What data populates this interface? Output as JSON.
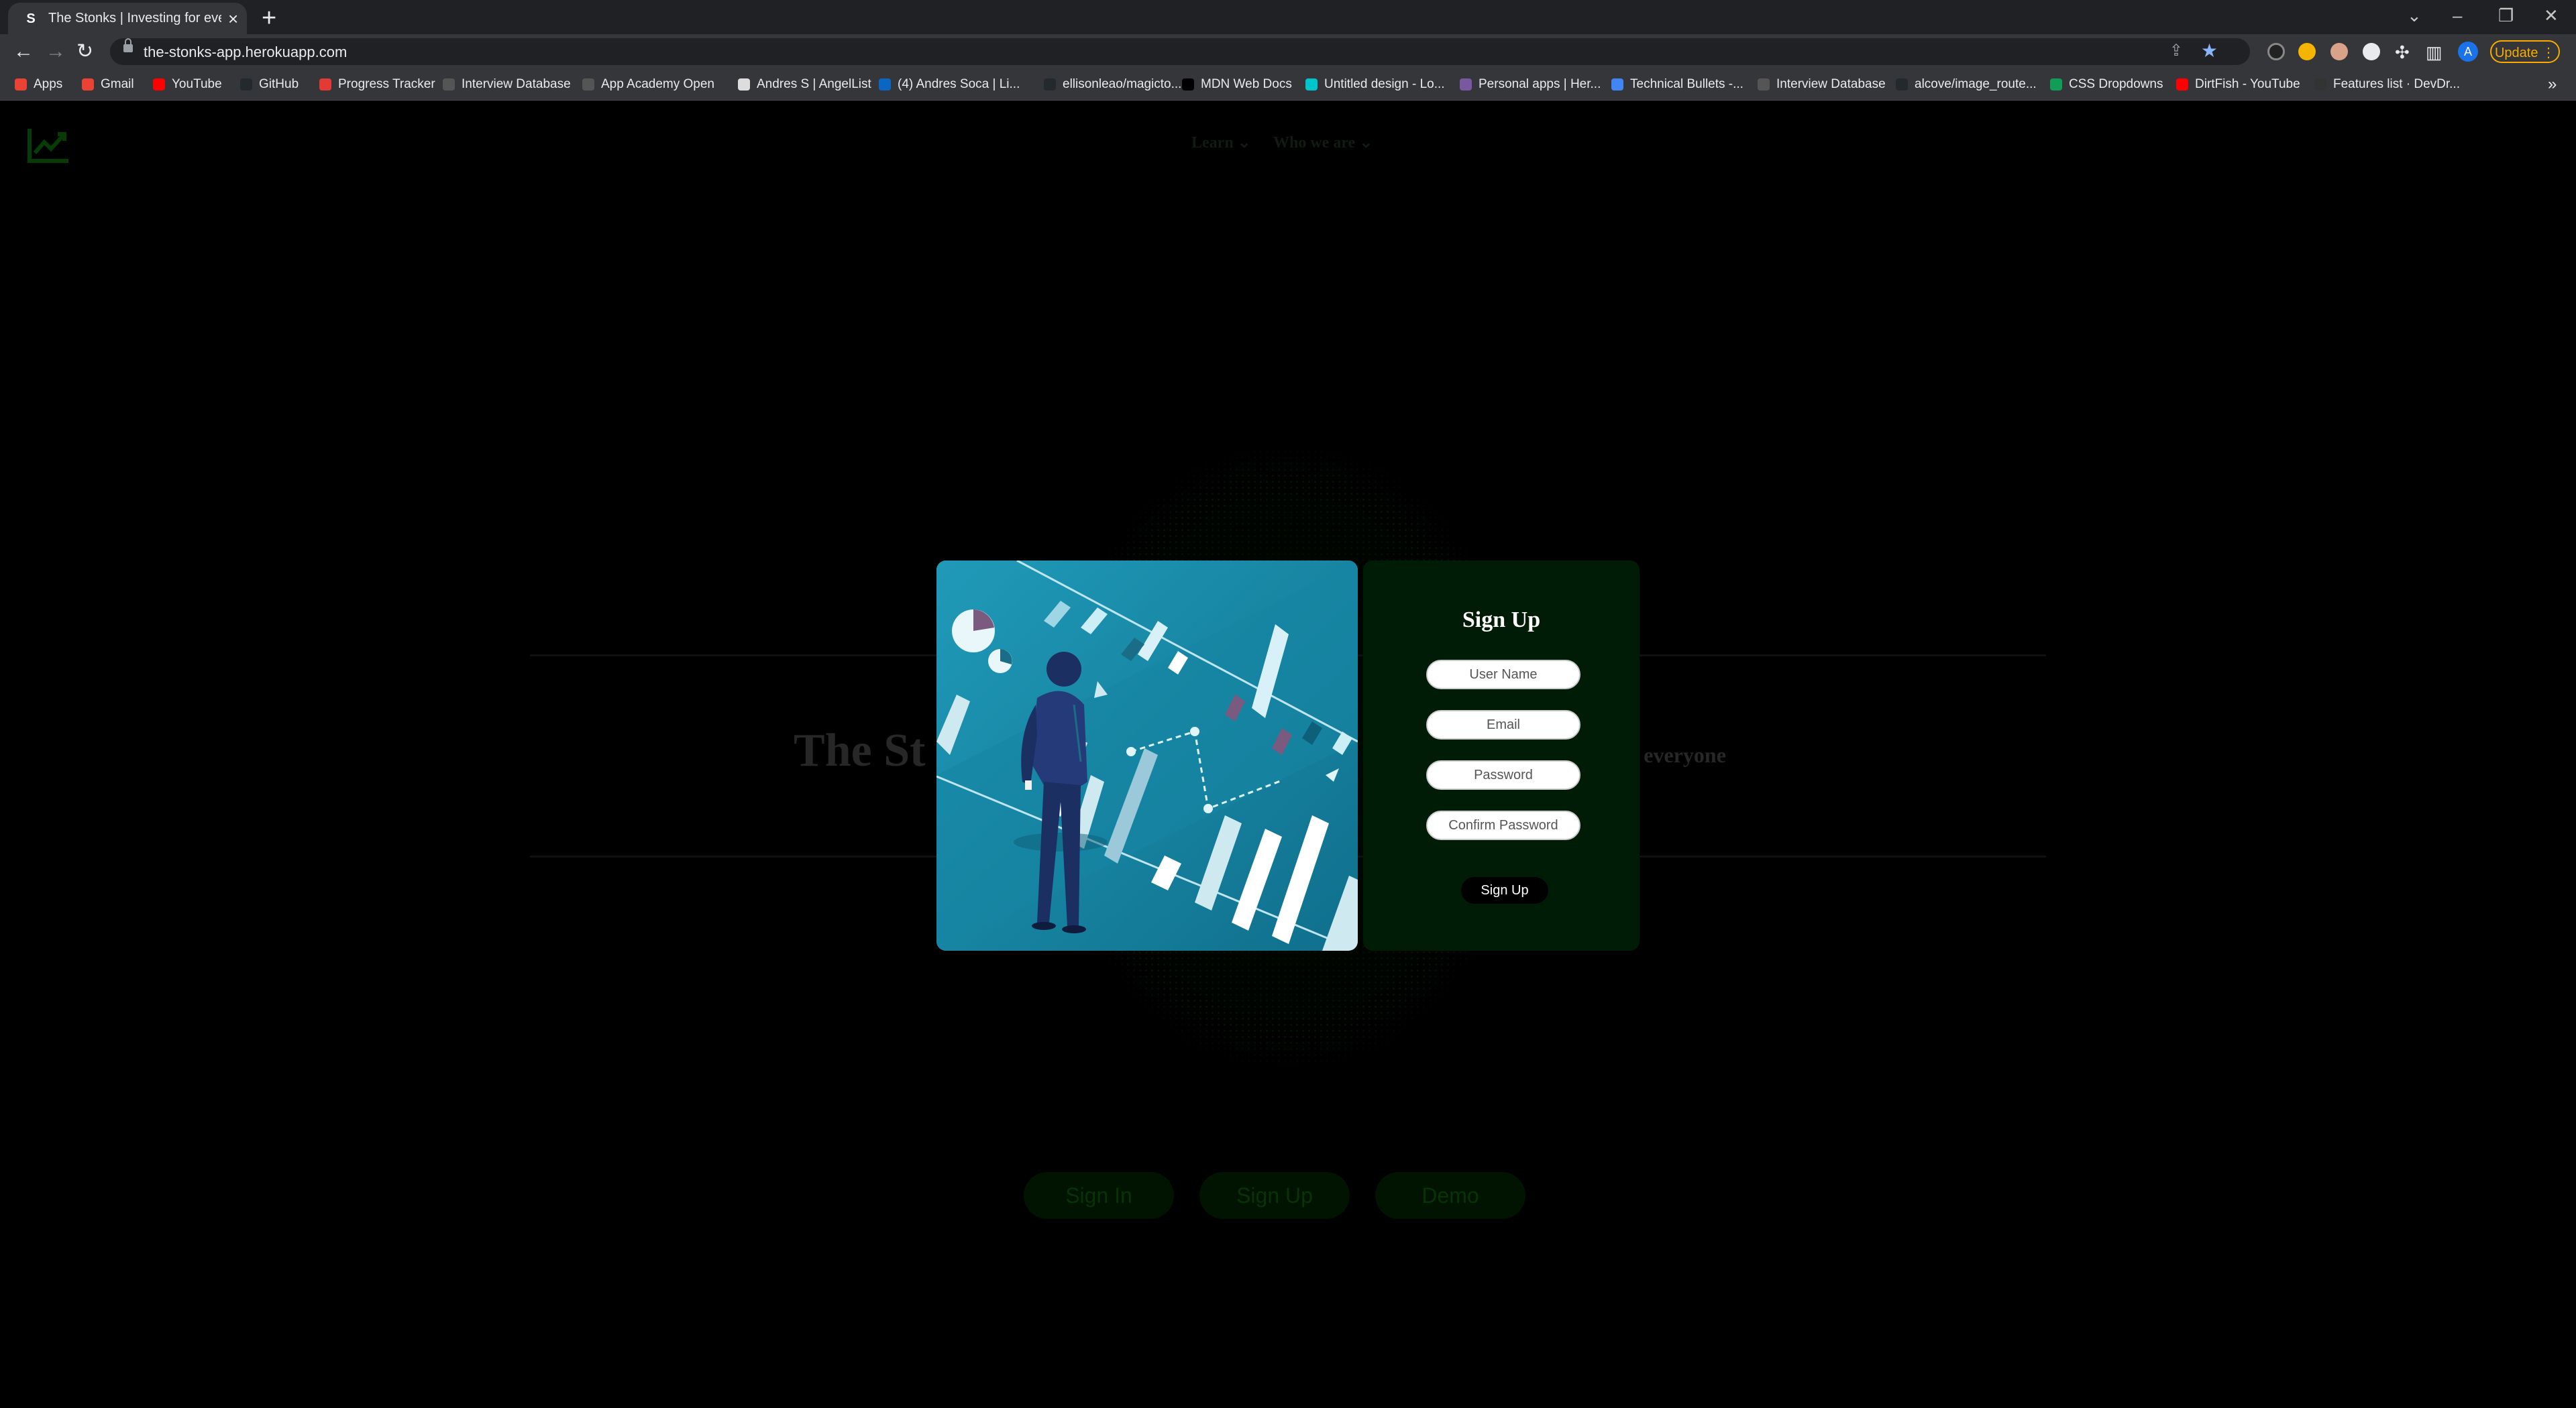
{
  "browser": {
    "tab_title": "The Stonks | Investing for everyo",
    "tab_favicon": "S",
    "new_tab": "+",
    "url": "the-stonks-app.herokuapp.com",
    "profile_initial": "A",
    "update_label": "Update",
    "bookmarks": [
      {
        "label": "Apps",
        "color": "#ea4335"
      },
      {
        "label": "Gmail",
        "color": "#ea4335"
      },
      {
        "label": "YouTube",
        "color": "#ff0000"
      },
      {
        "label": "GitHub",
        "color": "#24292e"
      },
      {
        "label": "Progress Tracker",
        "color": "#e53935"
      },
      {
        "label": "Interview Database",
        "color": "#555555"
      },
      {
        "label": "App Academy Open",
        "color": "#555555"
      },
      {
        "label": "Andres S | AngelList",
        "color": "#dddddd"
      },
      {
        "label": "(4) Andres Soca | Li...",
        "color": "#0a66c2"
      },
      {
        "label": "ellisonleao/magicto...",
        "color": "#24292e"
      },
      {
        "label": "MDN Web Docs",
        "color": "#000000"
      },
      {
        "label": "Untitled design - Lo...",
        "color": "#00c4cc"
      },
      {
        "label": "Personal apps | Her...",
        "color": "#79589f"
      },
      {
        "label": "Technical Bullets -...",
        "color": "#4285f4"
      },
      {
        "label": "Interview Database",
        "color": "#555555"
      },
      {
        "label": "alcove/image_route...",
        "color": "#24292e"
      },
      {
        "label": "CSS Dropdowns",
        "color": "#0f9d58"
      },
      {
        "label": "DirtFish - YouTube",
        "color": "#ff0000"
      },
      {
        "label": "Features list · DevDr...",
        "color": "#333333"
      }
    ],
    "more_bookmarks": "»"
  },
  "site": {
    "nav": [
      {
        "label": "Learn",
        "caret": "⌄"
      },
      {
        "label": "Who we are",
        "caret": "⌄"
      }
    ],
    "hero_title_visible": "The St",
    "hero_tagline_visible": "g for everyone",
    "cta_buttons": [
      "Sign In",
      "Sign Up",
      "Demo"
    ],
    "accent_color": "#0b4d0b"
  },
  "modal": {
    "title": "Sign Up",
    "fields": [
      {
        "placeholder": "User Name"
      },
      {
        "placeholder": "Email"
      },
      {
        "placeholder": "Password"
      },
      {
        "placeholder": "Confirm Password"
      }
    ],
    "submit_label": "Sign Up",
    "illustration": "businessman-bar-chart-illustration"
  }
}
